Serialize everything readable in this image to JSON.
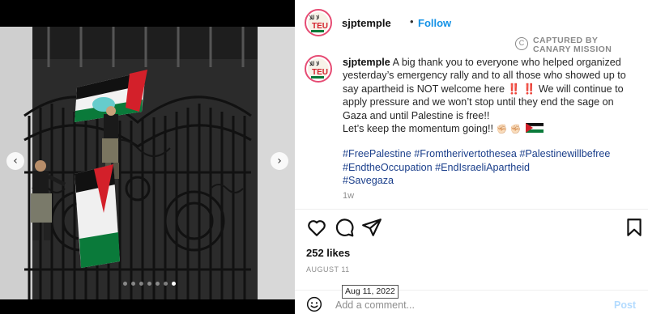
{
  "header": {
    "username": "sjptemple",
    "separator": "•",
    "follow_label": "Follow"
  },
  "avatar": {
    "line1": "لا للاحتلال",
    "line2": "TEU",
    "brand_color": "#e64b73"
  },
  "watermark": {
    "line1": "CAPTURED BY",
    "line2": "CANARY MISSION",
    "icon": "info-icon"
  },
  "caption": {
    "username": "sjptemple",
    "lines": [
      "A big thank you to everyone who helped organized",
      "yesterday’s emergency rally and to all those who showed up to",
      "say apartheid is NOT welcome here",
      "We will continue to",
      "apply pressure and we won’t stop until they end the sage on",
      "Gaza and until Palestine is free!!",
      "Let’s keep the momentum going!!"
    ],
    "excl_marks": "‼️ ‼️",
    "fist_emoji": "✊🏻 ✊🏻",
    "hashtags": [
      "#FreePalestine #Fromtherivertothesea #Palestinewillbefree",
      "#EndtheOccupation #EndIsraeliApartheid",
      "#Savegaza"
    ]
  },
  "post_age": "1w",
  "actions": {
    "like": "heart-icon",
    "comment": "comment-icon",
    "share": "send-icon",
    "save": "bookmark-icon"
  },
  "likes": "252 likes",
  "post_date": "AUGUST 11",
  "date_tooltip": "Aug 11, 2022",
  "comment": {
    "placeholder": "Add a comment...",
    "post_label": "Post",
    "emoji_icon": "smiley-icon"
  },
  "media": {
    "prev_label": "‹",
    "next_label": "›",
    "dots_count": 7,
    "active_dot": 6
  },
  "colors": {
    "link": "#1492e6",
    "hashtag": "#1b3f8b",
    "post_disabled": "#b3dbff",
    "flag_red": "#d3202a",
    "flag_green": "#0a7a3a"
  }
}
